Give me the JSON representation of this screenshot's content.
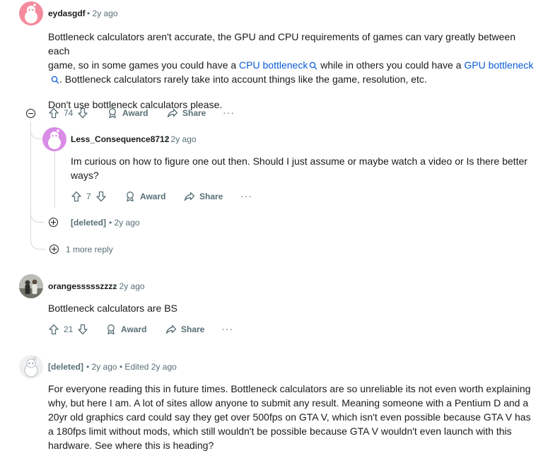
{
  "comments": [
    {
      "author": "eydasgdf",
      "meta": "• 2y ago",
      "body_lines": [
        [
          "Bottleneck calculators aren't accurate, the GPU and CPU requirements of games can vary greatly between each"
        ],
        [
          "game, so in some games you could have a ",
          "CPU bottleneck",
          " while in others you could have a ",
          "GPU bottleneck"
        ],
        [
          "",
          ". Bottleneck calculators rarely take into account things like the game, resolution, etc."
        ]
      ],
      "body_p2": "Don't use bottleneck calculators please.",
      "links": [
        "CPU bottleneck",
        "GPU bottleneck"
      ],
      "votes": "74",
      "award": "Award",
      "share": "Share",
      "more": "···"
    },
    {
      "author": "Less_Consequence8712",
      "meta": "• 2y ago",
      "body": "Im curious on how to figure one out then. Should I just assume or maybe watch a video or Is there better ways?",
      "votes": "7",
      "award": "Award",
      "share": "Share",
      "more": "···"
    },
    {
      "author": "[deleted]",
      "meta": "• 2y ago"
    },
    {
      "more_replies": "1 more reply"
    },
    {
      "author": "orangessssszzzz",
      "meta": "• 2y ago",
      "body": "Bottleneck calculators are BS",
      "votes": "21",
      "award": "Award",
      "share": "Share",
      "more": "···"
    },
    {
      "author": "[deleted]",
      "meta": "• 2y ago • Edited 2y ago",
      "body": "For everyone reading this in future times. Bottleneck calculators are so unreliable its not even worth explaining why, but here I am. A lot of sites allow anyone to submit any result. Meaning someone with a Pentium D and a 20yr old graphics card could say they get over 500fps on GTA V, which isn't even possible because GTA V has a 180fps limit without mods, which still wouldn't be possible because GTA V wouldn't even launch with this hardware. See where this is heading?"
    }
  ],
  "colors": {
    "text": "#1a1a1b",
    "meta": "#576f76",
    "link": "#0b5cd7",
    "thread_line": "#d7dadc",
    "avatar_pink": "#f48a9d",
    "avatar_purple": "#d98ce6"
  }
}
